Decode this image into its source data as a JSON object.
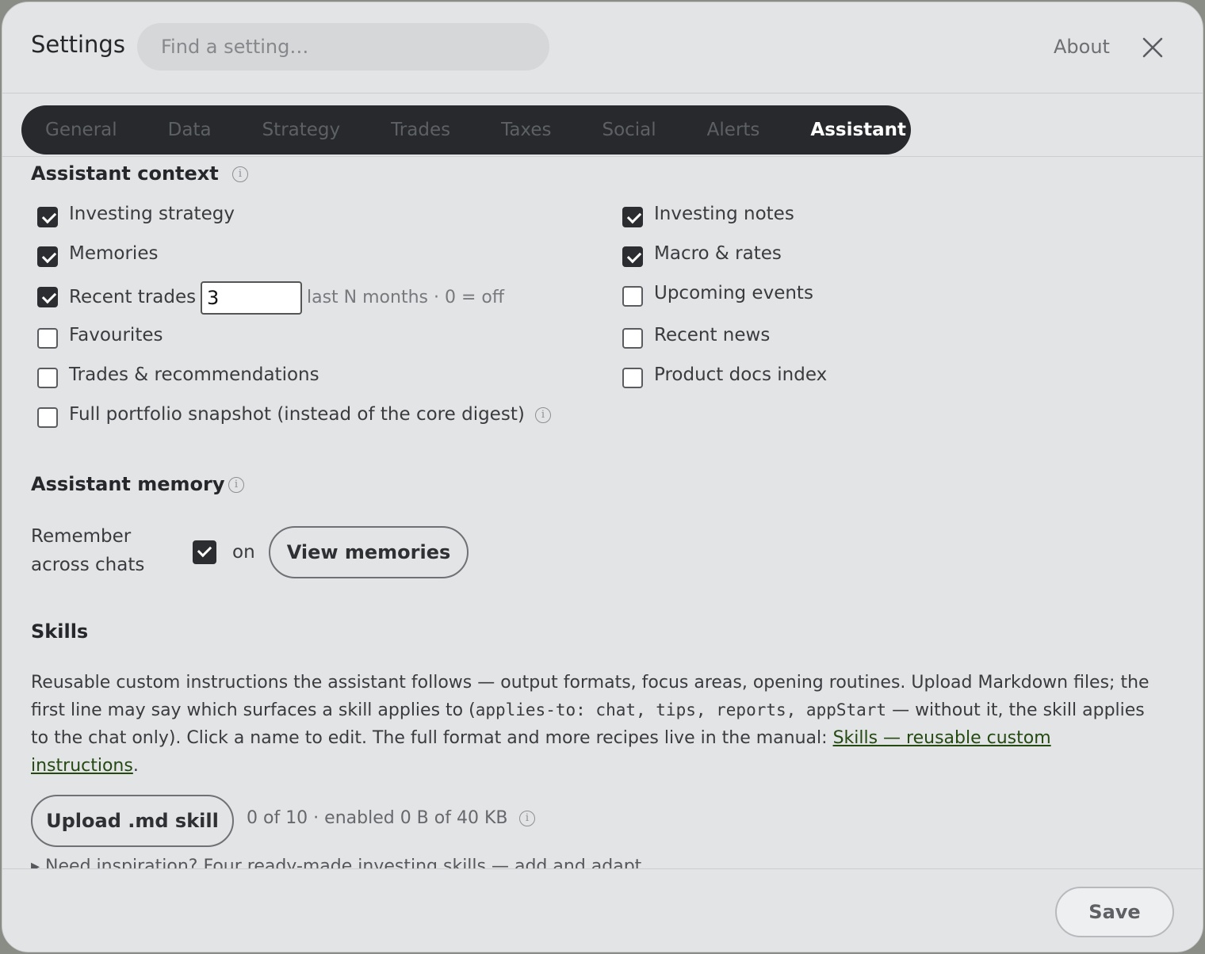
{
  "header": {
    "title": "Settings",
    "search_placeholder": "Find a setting…",
    "about_label": "About"
  },
  "tabs": [
    "General",
    "Data",
    "Strategy",
    "Trades",
    "Taxes",
    "Social",
    "Alerts",
    "Assistant"
  ],
  "active_tab": "Assistant",
  "context": {
    "heading": "Assistant context",
    "info_glyph": "i",
    "left": [
      {
        "label": "Investing strategy",
        "checked": true
      },
      {
        "label": "Memories",
        "checked": true
      },
      {
        "label": "Recent trades",
        "checked": true
      },
      {
        "label": "Favourites",
        "checked": false
      },
      {
        "label": "Trades & recommendations",
        "checked": false
      },
      {
        "label": "Full portfolio snapshot (instead of the core digest)",
        "checked": false
      }
    ],
    "right": [
      {
        "label": "Investing notes",
        "checked": true
      },
      {
        "label": "Macro & rates",
        "checked": true
      },
      {
        "label": "Upcoming events",
        "checked": false
      },
      {
        "label": "Recent news",
        "checked": false
      },
      {
        "label": "Product docs index",
        "checked": false
      }
    ],
    "recent_trades_months": "3",
    "recent_trades_hint": "last N months · 0 = off"
  },
  "memory": {
    "heading": "Assistant memory",
    "remember_label_line1": "Remember",
    "remember_label_line2": "across chats",
    "remember_checked": true,
    "state_label": "on",
    "view_button": "View memories"
  },
  "skills": {
    "heading": "Skills",
    "desc_1": "Reusable custom instructions the assistant follows — output formats, focus areas, opening routines. Upload Markdown files; the first line may say which surfaces a skill applies to (",
    "desc_code": "applies-to: chat, tips, reports, appStart",
    "desc_2": " — without it, the skill applies to the chat only). Click a name to edit. The full format and more recipes live in the manual: ",
    "manual_link": "Skills — reusable custom instructions",
    "desc_end": ".",
    "upload_button": "Upload .md skill",
    "status": "0 of 10 · enabled 0 B of 40 KB",
    "inspiration": "▸ Need inspiration? Four ready-made investing skills — add and adapt"
  },
  "footer": {
    "save_label": "Save"
  },
  "colors": {
    "tab_bar": "#27292c",
    "dialog_bg": "#e3e4e6",
    "link": "#244a12"
  }
}
